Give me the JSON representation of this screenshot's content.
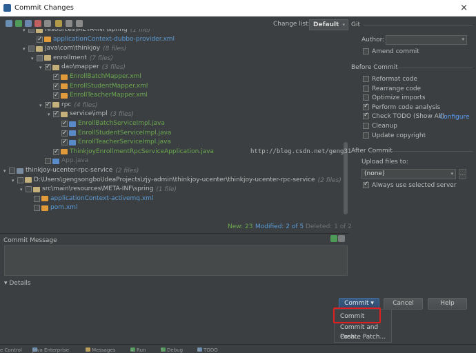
{
  "window": {
    "title": "Commit Changes",
    "close": "×"
  },
  "toolbar": {
    "changelist_label": "Change list:",
    "changelist_value": "Default",
    "changelist_arrow": "▾",
    "git_label": "Git"
  },
  "tree": [
    {
      "indent": 28,
      "tog": "▾",
      "cb": "part",
      "icon": "folder",
      "label": "resources\\META-INF\\spring",
      "note": "(1 file)",
      "cls": ""
    },
    {
      "indent": 40,
      "tog": "",
      "cb": "on",
      "icon": "xml",
      "label": "applicationContext-dubbo-provider.xml",
      "note": "",
      "cls": "blue"
    },
    {
      "indent": 28,
      "tog": "▾",
      "cb": "part",
      "icon": "folder",
      "label": "java\\com\\thinkjoy",
      "note": "(8 files)",
      "cls": ""
    },
    {
      "indent": 40,
      "tog": "▾",
      "cb": "part",
      "icon": "folder",
      "label": "enrollment",
      "note": "(7 files)",
      "cls": ""
    },
    {
      "indent": 52,
      "tog": "▾",
      "cb": "on",
      "icon": "folder",
      "label": "dao\\mapper",
      "note": "(3 files)",
      "cls": ""
    },
    {
      "indent": 64,
      "tog": "",
      "cb": "on",
      "icon": "xml",
      "label": "EnrollBatchMapper.xml",
      "note": "",
      "cls": "green"
    },
    {
      "indent": 64,
      "tog": "",
      "cb": "on",
      "icon": "xml",
      "label": "EnrollStudentMapper.xml",
      "note": "",
      "cls": "green"
    },
    {
      "indent": 64,
      "tog": "",
      "cb": "on",
      "icon": "xml",
      "label": "EnrollTeacherMapper.xml",
      "note": "",
      "cls": "green"
    },
    {
      "indent": 52,
      "tog": "▾",
      "cb": "on",
      "icon": "folder",
      "label": "rpc",
      "note": "(4 files)",
      "cls": ""
    },
    {
      "indent": 64,
      "tog": "▾",
      "cb": "on",
      "icon": "folder",
      "label": "service\\impl",
      "note": "(3 files)",
      "cls": ""
    },
    {
      "indent": 76,
      "tog": "",
      "cb": "on",
      "icon": "java",
      "label": "EnrollBatchServiceImpl.java",
      "note": "",
      "cls": "green"
    },
    {
      "indent": 76,
      "tog": "",
      "cb": "on",
      "icon": "java",
      "label": "EnrollStudentServiceImpl.java",
      "note": "",
      "cls": "green"
    },
    {
      "indent": 76,
      "tog": "",
      "cb": "on",
      "icon": "java",
      "label": "EnrollTeacherServiceImpl.java",
      "note": "",
      "cls": "green"
    },
    {
      "indent": 64,
      "tog": "",
      "cb": "on",
      "icon": "xml",
      "label": "ThinkjoyEnrollmentRpcServiceApplication.java",
      "note": "",
      "cls": "green"
    },
    {
      "indent": 52,
      "tog": "",
      "cb": "",
      "icon": "java",
      "label": "App.java",
      "note": "",
      "cls": "grey"
    },
    {
      "indent": 0,
      "tog": "▾",
      "cb": "",
      "icon": "mod",
      "label": "thinkjoy-ucenter-rpc-service",
      "note": "(2 files)",
      "cls": ""
    },
    {
      "indent": 12,
      "tog": "▾",
      "cb": "",
      "icon": "folder",
      "label": "D:\\Users\\gengsongbo\\IdeaProjects\\zjy-admin\\thinkjoy-ucenter\\thinkjoy-ucenter-rpc-service",
      "note": "(2 files)",
      "cls": ""
    },
    {
      "indent": 24,
      "tog": "▾",
      "cb": "",
      "icon": "folder",
      "label": "src\\main\\resources\\META-INF\\spring",
      "note": "(1 file)",
      "cls": ""
    },
    {
      "indent": 36,
      "tog": "",
      "cb": "",
      "icon": "xml",
      "label": "applicationContext-activemq.xml",
      "note": "",
      "cls": "blue"
    },
    {
      "indent": 36,
      "tog": "",
      "cb": "",
      "icon": "xml",
      "label": "pom.xml",
      "note": "",
      "cls": "blue"
    }
  ],
  "status": {
    "new": "New: 23",
    "modified": "Modified: 2 of 5",
    "deleted": "Deleted: 1 of 2"
  },
  "commit_message": {
    "label": "Commit Message",
    "value": ""
  },
  "details": {
    "label": "▾ Details"
  },
  "git": {
    "author_label": "Author:",
    "amend": "Amend commit",
    "before_commit": "Before Commit",
    "options": [
      {
        "label": "Reformat code",
        "checked": false
      },
      {
        "label": "Rearrange code",
        "checked": false
      },
      {
        "label": "Optimize imports",
        "checked": false
      },
      {
        "label": "Perform code analysis",
        "checked": true
      },
      {
        "label": "Check TODO (Show All)",
        "checked": true
      },
      {
        "label": "Cleanup",
        "checked": false
      },
      {
        "label": "Update copyright",
        "checked": false
      }
    ],
    "configure": "Configure",
    "after_commit": "After Commit",
    "upload_label": "Upload files to:",
    "upload_value": "(none)",
    "upload_more": "...",
    "always_selected": "Always use selected server"
  },
  "watermark": "http://blog.csdn.net/geng31",
  "buttons": {
    "commit": "Commit ▾",
    "cancel": "Cancel",
    "help": "Help"
  },
  "menu": [
    "Commit",
    "Commit and Push...",
    "Create Patch..."
  ],
  "bottombar": [
    "e Control",
    "Java Enterprise",
    "0: Messages",
    "4: Run",
    "5: Debug",
    "6: TODO"
  ]
}
